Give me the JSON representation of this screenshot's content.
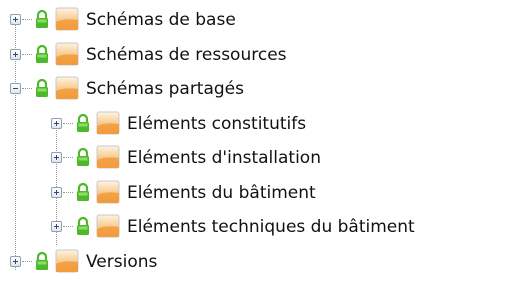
{
  "tree": {
    "nodes": [
      {
        "label": "Schémas de base",
        "level": 0,
        "state": "collapsed"
      },
      {
        "label": "Schémas de ressources",
        "level": 0,
        "state": "collapsed"
      },
      {
        "label": "Schémas partagés",
        "level": 0,
        "state": "expanded"
      },
      {
        "label": "Eléments constitutifs",
        "level": 1,
        "state": "collapsed"
      },
      {
        "label": "Eléments d'installation",
        "level": 1,
        "state": "collapsed"
      },
      {
        "label": "Eléments du bâtiment",
        "level": 1,
        "state": "collapsed"
      },
      {
        "label": "Eléments techniques du bâtiment",
        "level": 1,
        "state": "collapsed"
      },
      {
        "label": "Versions",
        "level": 0,
        "state": "collapsed"
      }
    ],
    "icons": {
      "lock": "lock-icon",
      "folder": "schema-folder-icon",
      "expand": "expand-plus-icon",
      "collapse": "collapse-minus-icon"
    },
    "colors": {
      "lock_green": "#4cb82a",
      "folder_orange": "#f29a3c",
      "folder_light": "#fdf3e3"
    }
  }
}
